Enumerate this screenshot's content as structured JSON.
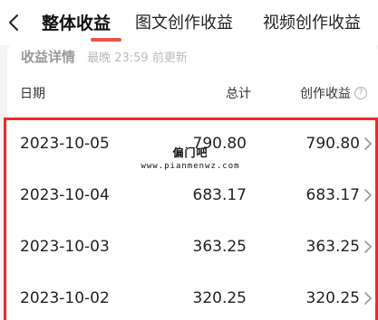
{
  "header": {
    "tabs": [
      {
        "label": "整体收益",
        "active": true
      },
      {
        "label": "图文创作收益",
        "active": false
      },
      {
        "label": "视频创作收益",
        "active": false
      }
    ],
    "accent_color": "#f0504a"
  },
  "details": {
    "title": "收益详情",
    "updated": "最晚 23:59 前更新"
  },
  "table": {
    "columns": {
      "date": "日期",
      "total": "总计",
      "creation": "创作收益"
    },
    "rows": [
      {
        "date": "2023-10-05",
        "total": "790.80",
        "creation": "790.80"
      },
      {
        "date": "2023-10-04",
        "total": "683.17",
        "creation": "683.17"
      },
      {
        "date": "2023-10-03",
        "total": "363.25",
        "creation": "363.25"
      },
      {
        "date": "2023-10-02",
        "total": "320.25",
        "creation": "320.25"
      }
    ]
  },
  "watermark": {
    "name": "偏门吧",
    "url": "www.pianmenwz.com"
  },
  "highlight_color": "#ee2a24"
}
